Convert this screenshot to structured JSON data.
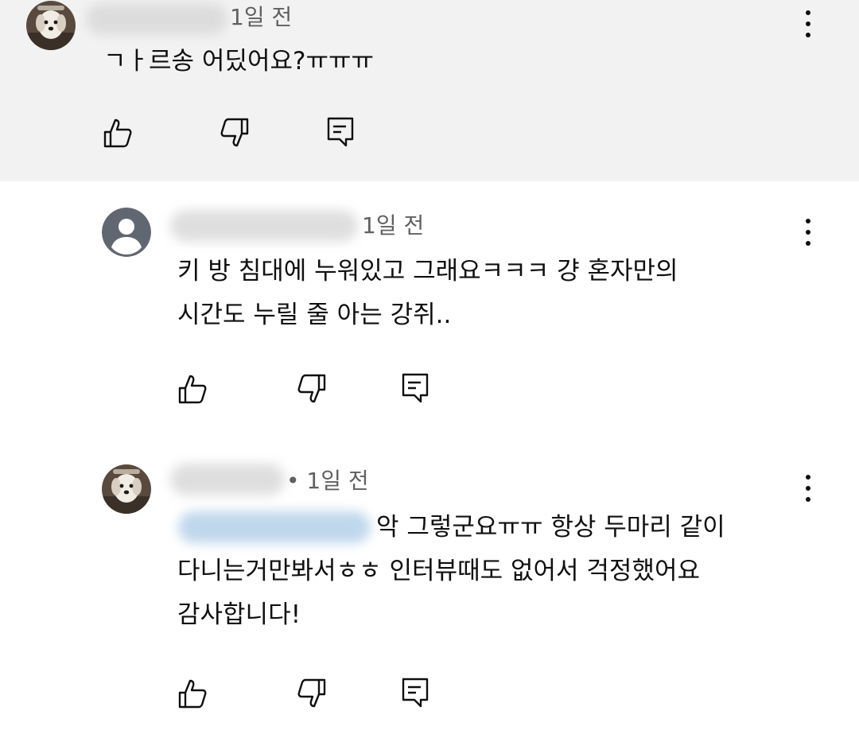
{
  "comments": [
    {
      "time": "1일 전",
      "lines": [
        "ㄱㅏ르송 어딨어요?ㅠㅠㅠ"
      ]
    },
    {
      "time": "1일 전",
      "lines": [
        "키 방 침대에 누워있고 그래요ㅋㅋㅋ 걍 혼자만의",
        "시간도 누릴 줄 아는 강쥐.."
      ]
    },
    {
      "time": "• 1일 전",
      "lines": [
        "악 그렇군요ㅠㅠ 항상 두마리 같이",
        "다니는거만봐서ㅎㅎ 인터뷰때도 없어서 걱정했어요",
        "감사합니다!"
      ]
    }
  ],
  "icons": {
    "like": "thumbs-up-icon",
    "dislike": "thumbs-down-icon",
    "reply": "reply-icon",
    "menu": "more-vert-icon"
  },
  "colors": {
    "top_background": "#f2f2f2",
    "background": "#ffffff",
    "text": "#0f0f0f",
    "secondary_text": "#606060",
    "default_avatar": "#606770"
  }
}
